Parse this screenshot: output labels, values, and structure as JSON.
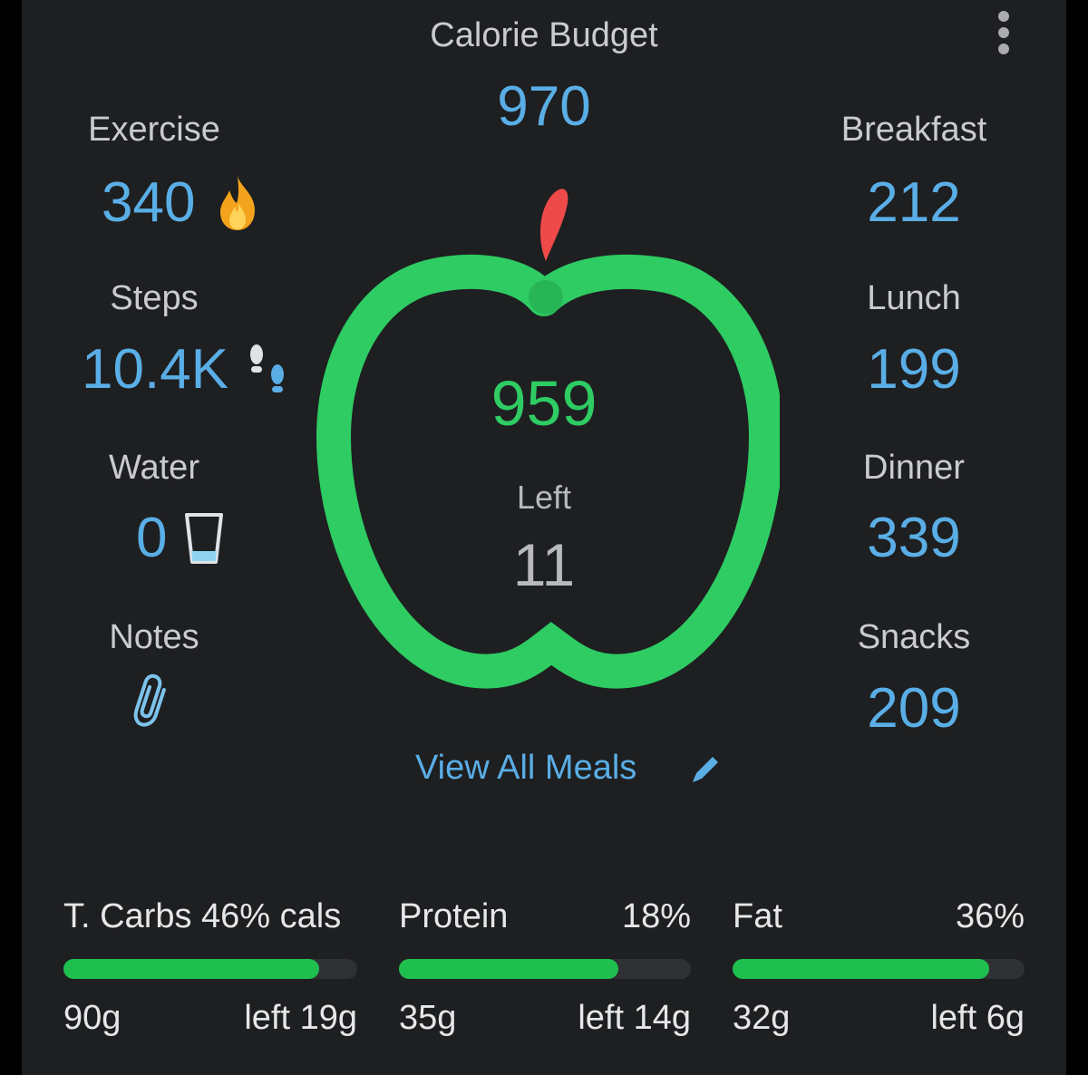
{
  "header": {
    "title": "Calorie Budget",
    "budget": "970"
  },
  "left": {
    "exercise": {
      "label": "Exercise",
      "value": "340",
      "icon": "flame-icon"
    },
    "steps": {
      "label": "Steps",
      "value": "10.4K",
      "icon": "footsteps-icon"
    },
    "water": {
      "label": "Water",
      "value": "0",
      "icon": "glass-icon"
    },
    "notes": {
      "label": "Notes",
      "icon": "paperclip-icon"
    }
  },
  "right": {
    "breakfast": {
      "label": "Breakfast",
      "value": "212"
    },
    "lunch": {
      "label": "Lunch",
      "value": "199"
    },
    "dinner": {
      "label": "Dinner",
      "value": "339"
    },
    "snacks": {
      "label": "Snacks",
      "value": "209"
    }
  },
  "apple": {
    "consumed": "959",
    "left_label": "Left",
    "left_value": "11",
    "ring_color": "#2ecc63",
    "leaf_color": "#ef4a4a"
  },
  "view_all": {
    "label": "View All Meals",
    "icon": "pencil-icon"
  },
  "macros": [
    {
      "name": "T. Carbs 46% cals",
      "percent": "",
      "grams": "90g",
      "left": "left 19g",
      "fill": 0.87
    },
    {
      "name": "Protein",
      "percent": "18%",
      "grams": "35g",
      "left": "left 14g",
      "fill": 0.75
    },
    {
      "name": "Fat",
      "percent": "36%",
      "grams": "32g",
      "left": "left 6g",
      "fill": 0.88
    }
  ],
  "colors": {
    "accent": "#5aaee6",
    "green": "#2ecc63",
    "background": "#1e1f21"
  }
}
